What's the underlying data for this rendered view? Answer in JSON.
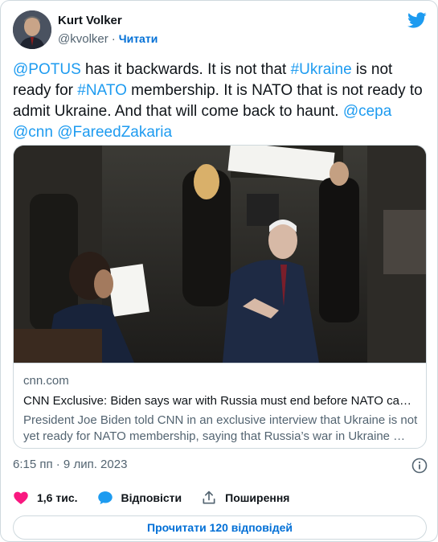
{
  "user": {
    "display_name": "Kurt Volker",
    "handle": "@kvolker",
    "follow_label": "Читати"
  },
  "tweet": {
    "parts": [
      {
        "text": "@POTUS",
        "link": true
      },
      {
        "text": " has it backwards.  It is not that ",
        "link": false
      },
      {
        "text": "#Ukraine",
        "link": true
      },
      {
        "text": " is not ready for ",
        "link": false
      },
      {
        "text": "#NATO",
        "link": true
      },
      {
        "text": " membership.  It is NATO that is not ready to admit Ukraine.  And that will come back to haunt. ",
        "link": false
      },
      {
        "text": "@cepa",
        "link": true
      },
      {
        "text": " ",
        "link": false
      },
      {
        "text": "@cnn",
        "link": true
      },
      {
        "text": " ",
        "link": false
      },
      {
        "text": "@FareedZakaria",
        "link": true
      }
    ]
  },
  "link_card": {
    "domain": "cnn.com",
    "title": "CNN Exclusive: Biden says war with Russia must end before NATO can c…",
    "description": "President Joe Biden told CNN in an exclusive interview that Ukraine is not yet ready for NATO membership, saying that Russia’s war in Ukraine …"
  },
  "timestamp": "6:15 пп · 9 лип. 2023",
  "actions": {
    "likes": "1,6 тис.",
    "reply_label": "Відповісти",
    "share_label": "Поширення"
  },
  "read_replies_label": "Прочитати 120 відповідей",
  "icons": {
    "brand": "twitter-bird-icon",
    "like": "heart-icon",
    "reply": "speech-bubble-icon",
    "share": "share-icon",
    "info": "info-icon"
  },
  "colors": {
    "link": "#1d9bf0",
    "follow": "#006fd6",
    "like": "#f91880",
    "muted": "#536471",
    "border": "#cfd9de"
  }
}
